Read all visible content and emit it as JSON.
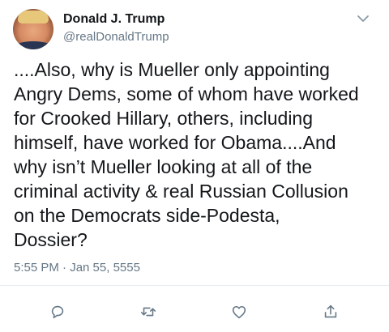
{
  "tweet": {
    "author_name": "Donald J. Trump",
    "author_handle": "@realDonaldTrump",
    "text": "....Also, why is Mueller only appointing\nAngry Dems, some of whom have worked\nfor Crooked Hillary, others, including\nhimself, have worked for Obama....And\nwhy isn’t Mueller looking at all of the\ncriminal activity & real Russian Collusion\non the Democrats side-Podesta,\nDossier?",
    "timestamp": "5:55 PM · Jan 55, 5555"
  },
  "actions": [
    {
      "icon": "reply-icon"
    },
    {
      "icon": "retweet-icon"
    },
    {
      "icon": "like-icon"
    },
    {
      "icon": "share-icon"
    }
  ],
  "colors": {
    "text": "#14171a",
    "secondary": "#657786",
    "divider": "#e6ecf0"
  }
}
